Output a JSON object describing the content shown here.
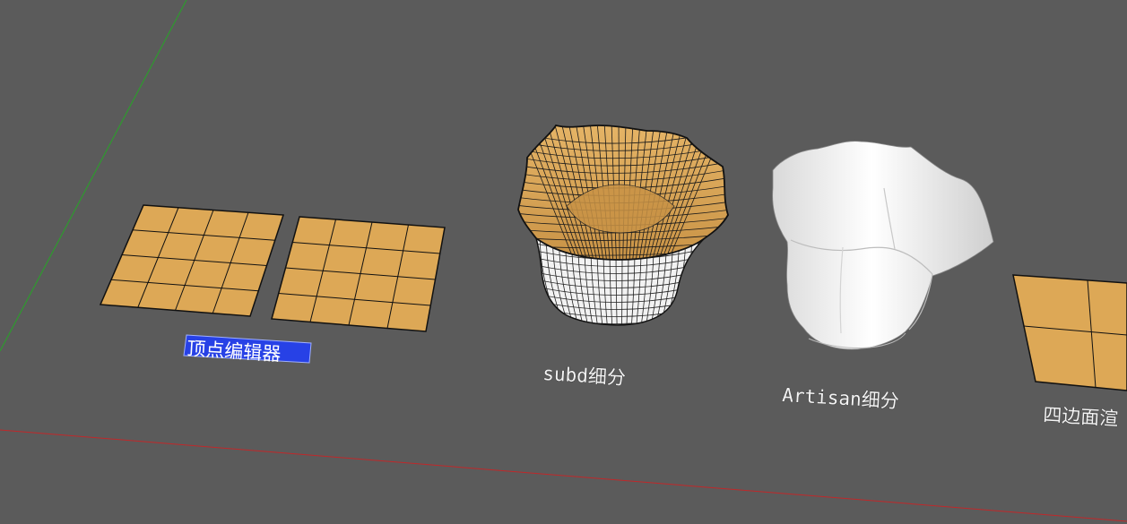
{
  "viewport": {
    "background": "#5b5b5b",
    "face_color": "#dda856",
    "edge_color": "#111111",
    "axis_green": "#2e9a2e",
    "axis_red": "#c0282a",
    "selection_color": "#2741e6"
  },
  "labels": {
    "vertex_editor": "顶点编辑器",
    "subd": "subd细分",
    "artisan": "Artisan细分",
    "quad_face": "四边面渲"
  }
}
